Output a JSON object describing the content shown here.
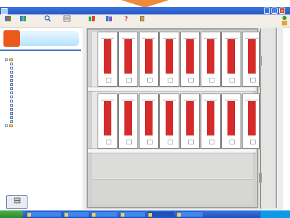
{
  "window": {
    "title": "",
    "controls": [
      "_",
      "□",
      "×"
    ]
  },
  "toolbar": [
    {
      "label": "",
      "icon": "books-icon"
    },
    {
      "label": "",
      "icon": "binder-edit-icon"
    },
    {
      "label": "",
      "icon": "search-icon"
    },
    {
      "label": "",
      "icon": "list-view-icon"
    },
    {
      "label": "",
      "icon": "management-icon"
    },
    {
      "label": "",
      "icon": "link-icon"
    },
    {
      "label": "",
      "icon": "help-icon"
    },
    {
      "label": "",
      "icon": "exit-icon"
    }
  ],
  "logo": {
    "mark": "",
    "text": ""
  },
  "tree": {
    "root": "",
    "items": [
      "",
      "",
      "",
      "",
      "",
      "",
      "",
      "",
      "",
      "",
      "",
      "",
      "",
      "",
      "",
      "",
      ""
    ]
  },
  "shelf": {
    "top": [
      {
        "label": ""
      },
      {
        "label": ""
      },
      {
        "label": ""
      },
      {
        "label": ""
      },
      {
        "label": ""
      },
      {
        "label": ""
      },
      {
        "label": ""
      },
      {
        "label": ""
      }
    ],
    "bottom": [
      {
        "label": ""
      },
      {
        "label": ""
      },
      {
        "label": ""
      },
      {
        "label": ""
      },
      {
        "label": ""
      },
      {
        "label": ""
      },
      {
        "label": ""
      },
      {
        "label": ""
      }
    ]
  },
  "shelf_button": {
    "label": ""
  },
  "taskbar": {
    "start_label": "",
    "tasks": [
      "",
      "",
      "",
      "",
      "",
      ""
    ],
    "clock": ""
  },
  "colors": {
    "binder_label": "#d62b2b",
    "logo_bg": "#e95a1c",
    "titlebar": "#2456c8",
    "taskbar": "#1f51c2"
  }
}
